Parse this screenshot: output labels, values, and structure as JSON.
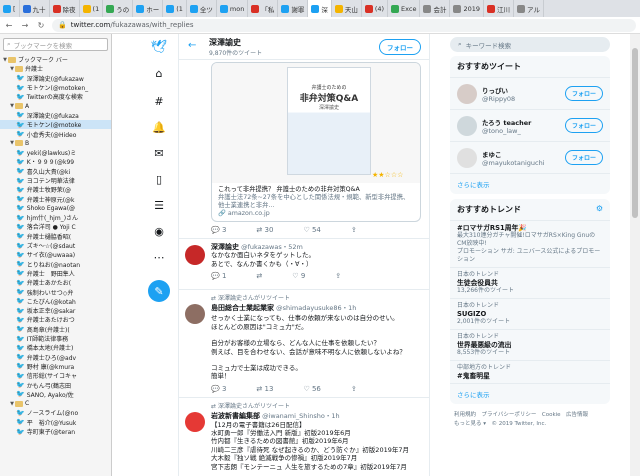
{
  "tabs": [
    {
      "label": "[",
      "color": "#1da1f2"
    },
    {
      "label": "九十",
      "color": "#2a6fdb"
    },
    {
      "label": "除夜",
      "color": "#d93025"
    },
    {
      "label": "(1",
      "color": "#f4b400"
    },
    {
      "label": "うの",
      "color": "#34a853"
    },
    {
      "label": "ホー",
      "color": "#1da1f2"
    },
    {
      "label": "(1",
      "color": "#1da1f2"
    },
    {
      "label": "全ツ",
      "color": "#1da1f2"
    },
    {
      "label": "mon",
      "color": "#1da1f2"
    },
    {
      "label": "「私",
      "color": "#d93025"
    },
    {
      "label": "謝罪",
      "color": "#1da1f2"
    },
    {
      "label": "深",
      "color": "#1da1f2"
    },
    {
      "label": "天山",
      "color": "#f4b400"
    },
    {
      "label": "(4)",
      "color": "#d93025"
    },
    {
      "label": "Exce",
      "color": "#34a853"
    },
    {
      "label": "会計",
      "color": "#888"
    },
    {
      "label": "2019",
      "color": "#888"
    },
    {
      "label": "江川",
      "color": "#d93025"
    },
    {
      "label": "アル",
      "color": "#888"
    }
  ],
  "address_bar": {
    "host": "twitter.com",
    "path": "/fukazawas/with_replies"
  },
  "bookmarks": {
    "search_placeholder": "ブックマークを検索",
    "rows": [
      {
        "label": "ブックマーク バー",
        "kind": "folder",
        "indent": 0,
        "expanded": true
      },
      {
        "label": "弁護士",
        "kind": "folder",
        "indent": 1,
        "expanded": true
      },
      {
        "label": "深澤論史(@fukazaw",
        "kind": "bird",
        "indent": 2
      },
      {
        "label": "モトケン(@motoken_",
        "kind": "bird",
        "indent": 2
      },
      {
        "label": "Twitterの高度な検索",
        "kind": "bird",
        "indent": 2
      },
      {
        "label": "A",
        "kind": "folder",
        "indent": 1,
        "expanded": true
      },
      {
        "label": "深澤論史(@fukaza",
        "kind": "bird",
        "indent": 2
      },
      {
        "label": "モトケン(@motoke",
        "kind": "bird",
        "indent": 2,
        "selected": true
      },
      {
        "label": "小倉秀夫(@Hideo",
        "kind": "bird",
        "indent": 2
      },
      {
        "label": "B",
        "kind": "folder",
        "indent": 1,
        "expanded": true
      },
      {
        "label": "yeki(@lawkus)ミ",
        "kind": "bird",
        "indent": 2
      },
      {
        "label": "K・９９９(@k99",
        "kind": "bird",
        "indent": 2
      },
      {
        "label": "喜久山大貴(@ki",
        "kind": "bird",
        "indent": 2
      },
      {
        "label": "ヨコテン明華法律",
        "kind": "bird",
        "indent": 2
      },
      {
        "label": "弁護士牧野茉(@",
        "kind": "bird",
        "indent": 2
      },
      {
        "label": "弁護士神原元(@k",
        "kind": "bird",
        "indent": 2
      },
      {
        "label": "Shoko Egawa(@",
        "kind": "bird",
        "indent": 2
      },
      {
        "label": "hjm什(_hjm_)さん",
        "kind": "bird",
        "indent": 2
      },
      {
        "label": "落合洋司 ● Yoji C",
        "kind": "bird",
        "indent": 2
      },
      {
        "label": "弁護士樋脇香昭(",
        "kind": "bird",
        "indent": 2
      },
      {
        "label": "ズキ～☆(@sdaut",
        "kind": "bird",
        "indent": 2
      },
      {
        "label": "サイ衣(@uwaaa)",
        "kind": "bird",
        "indent": 2
      },
      {
        "label": "とりねお(@naotan",
        "kind": "bird",
        "indent": 2
      },
      {
        "label": "弁護士　野田隼人",
        "kind": "bird",
        "indent": 2
      },
      {
        "label": "弁護士あかたお(",
        "kind": "bird",
        "indent": 2
      },
      {
        "label": "強制わいせつ◇弁",
        "kind": "bird",
        "indent": 2
      },
      {
        "label": "こたぴん(@kotah",
        "kind": "bird",
        "indent": 2
      },
      {
        "label": "坂本正幸(@sakar",
        "kind": "bird",
        "indent": 2
      },
      {
        "label": "弁護士あたけおつ",
        "kind": "bird",
        "indent": 2
      },
      {
        "label": "髙島章(弁護士)(",
        "kind": "bird",
        "indent": 2
      },
      {
        "label": "IT師範法律事務",
        "kind": "bird",
        "indent": 2
      },
      {
        "label": "橋本太地(弁護士)",
        "kind": "bird",
        "indent": 2
      },
      {
        "label": "弁護士ひろ(@adv",
        "kind": "bird",
        "indent": 2
      },
      {
        "label": "野村 康(@kmura",
        "kind": "bird",
        "indent": 2
      },
      {
        "label": "信形総(サイコキャ",
        "kind": "bird",
        "indent": 2
      },
      {
        "label": "かもん弓(鶴志田",
        "kind": "bird",
        "indent": 2
      },
      {
        "label": "SANO, Ayako/佐",
        "kind": "bird",
        "indent": 2
      },
      {
        "label": "C",
        "kind": "folder",
        "indent": 1,
        "expanded": true
      },
      {
        "label": "ノースライム(@no",
        "kind": "bird",
        "indent": 2
      },
      {
        "label": "平　裕介(@Yusuk",
        "kind": "bird",
        "indent": 2
      },
      {
        "label": "寺町東子(@teran",
        "kind": "bird",
        "indent": 2
      }
    ]
  },
  "profile_header": {
    "name": "深澤諭史",
    "tweets": "9,870件のツイート",
    "follow_label": "フォロー"
  },
  "book_card": {
    "cover_small": "弁護士のための",
    "cover_title": "非弁対策Q&A",
    "cover_author": "深澤諭史",
    "line1": "これって非弁提携？ 弁護士のための非弁対策Q&A",
    "line2": "弁護士法72条~27条を中心とした関係法規・規範、新型非弁提携、他士業連携と非弁...",
    "domain": "amazon.co.jp"
  },
  "actions_1": {
    "reply": "3",
    "retweet": "30",
    "like": "54"
  },
  "tweet_2": {
    "name": "深澤論史",
    "handle": "@fukazawas・52m",
    "text1": "なかなか面白いネタをゲットした。",
    "text2": "あとで、なんか書くかも（・∀・）",
    "reply": "1",
    "retweet": "",
    "like": "9"
  },
  "retweet_label_1": "深澤論史さんがリツイート",
  "tweet_3": {
    "name": "島田総合士業起業家",
    "handle": "@shimadayusuke86・1h",
    "lines": [
      "せっかく士業になっても、仕事の依頼が来ないのは自分のせい。",
      "ほとんどの原因は\"コミュ力\"だ。",
      "",
      "自分がお客様の立場なら、どんな人に仕事を依頼したい？",
      "例えば、目を合わせない、会話が意味不明な人に依頼しないよね？",
      "",
      "コミュ力で士業は成功できる。",
      "簡単！"
    ],
    "reply": "3",
    "retweet": "13",
    "like": "56"
  },
  "retweet_label_2": "深澤論史さんがリツイート",
  "tweet_4": {
    "name": "岩波新書編集部",
    "handle": "@iwanami_Shinsho・1h",
    "lines": [
      "【12月の電子書籍は26日配信】",
      "水町勇一郎『労働法入門 新版』初版2019年6月",
      "竹内都『生きるための図書館』初版2019年6月",
      "川崎二三彦『虐待死 なぜ起きるのか、どう防ぐか』初版2019年7月",
      "大木毅『独ソ戦 絶滅戦争の惨禍』初版2019年7月",
      "宮下志朗『モンテーニュ 人生を旅するための7章』初版2019年7月"
    ]
  },
  "right": {
    "search_placeholder": "キーワード検索",
    "who_title": "おすすめツイート",
    "users": [
      {
        "name": "りっぴい",
        "handle": "@Rippy08",
        "follow": "フォロー",
        "color": "#d7ccc8"
      },
      {
        "name": "たろう teacher",
        "handle": "@tono_law_",
        "follow": "フォロー",
        "color": "#cfd8dc"
      },
      {
        "name": "まゆこ",
        "handle": "@mayukotaniguchi",
        "follow": "フォロー",
        "color": "#e0e0e0"
      }
    ],
    "more_label": "さらに表示",
    "trends_title": "おすすめトレンド",
    "trends": [
      {
        "cat": "",
        "name": "#ロマサガRS1周年🎉",
        "count": "最大310連分ガチャ開催!ロマサガRS×King GnuのCM放映中!",
        "sub": "プロモーション サガ: ユニバース公式によるプロモーション"
      },
      {
        "cat": "日本のトレンド",
        "name": "生徒会役員共",
        "count": "13,266件のツイート",
        "sub": ""
      },
      {
        "cat": "日本のトレンド",
        "name": "SUGIZO",
        "count": "2,001件のツイート",
        "sub": ""
      },
      {
        "cat": "日本のトレンド",
        "name": "世界最悪級の流出",
        "count": "8,553件のツイート",
        "sub": ""
      },
      {
        "cat": "中部地方のトレンド",
        "name": "#鬼畜明星",
        "count": "",
        "sub": ""
      }
    ],
    "trends_more": "さらに表示",
    "footer1": "利用規約　プライバシーポリシー　Cookie　広告情報",
    "footer2": "もっと見る ▾　© 2019 Twitter, Inc."
  }
}
